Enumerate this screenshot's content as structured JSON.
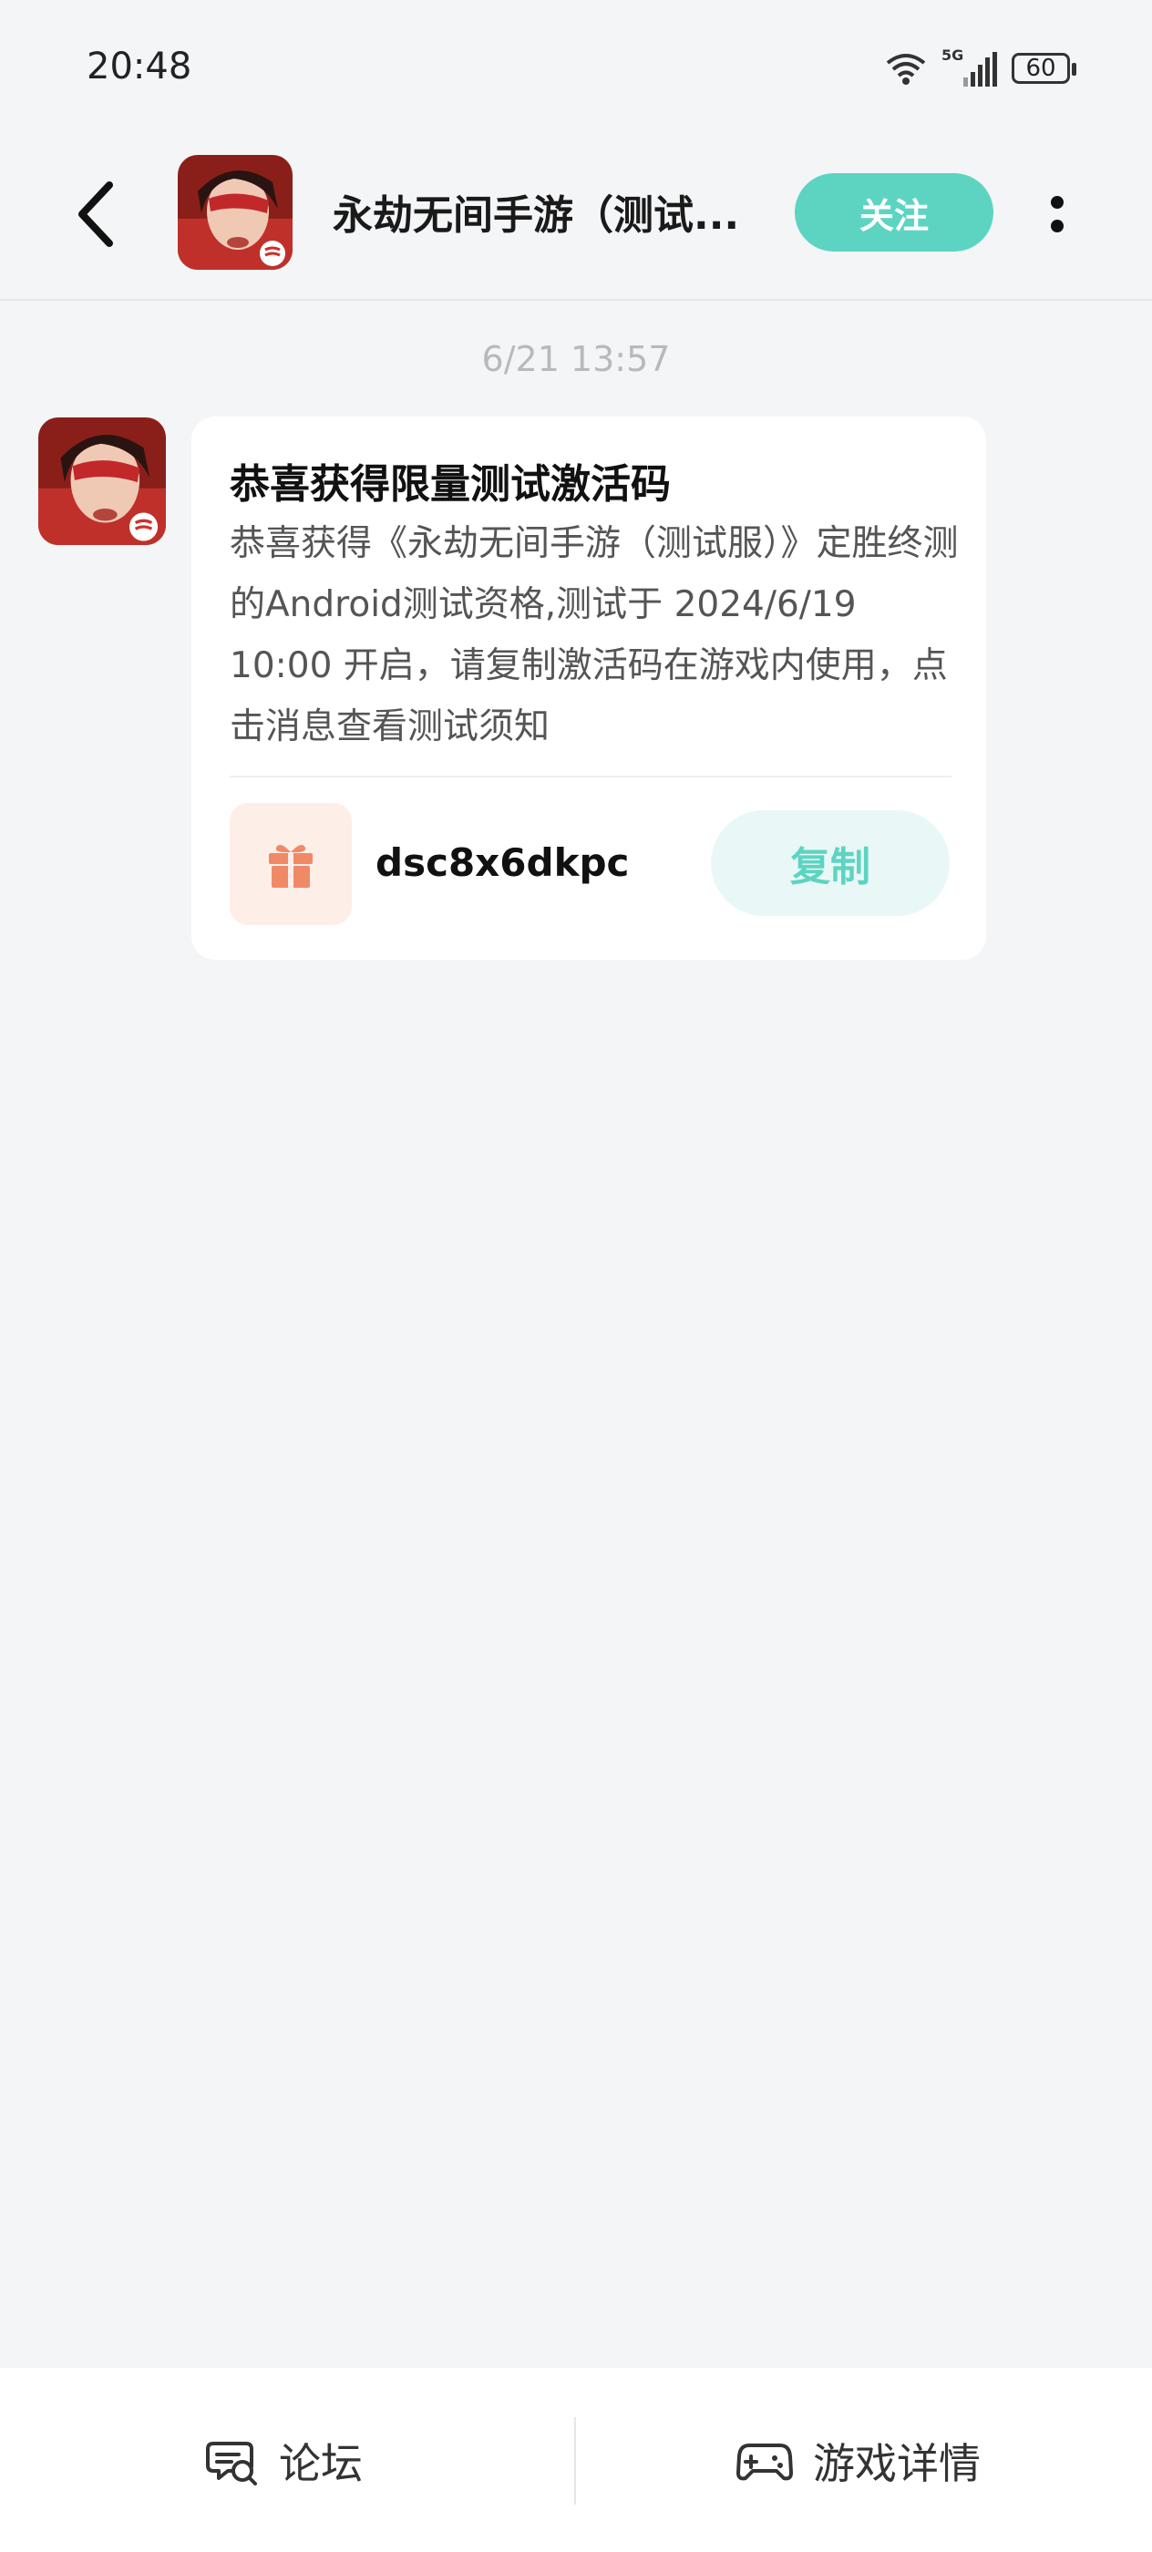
{
  "status_bar": {
    "time": "20:48",
    "network_label": "5G",
    "battery_level": "60"
  },
  "header": {
    "title": "永劫无间手游（测试...",
    "follow_label": "关注",
    "avatar_icon": "game-avatar-icon"
  },
  "conversation": {
    "timestamp": "6/21  13:57",
    "message": {
      "title": "恭喜获得限量测试激活码",
      "body": "恭喜获得《永劫无间手游（测试服）》定胜终测的Android测试资格,测试于 2024/6/19 10:00 开启，请复制激活码在游戏内使用，点击消息查看测试须知",
      "code": "dsc8x6dkpc",
      "copy_label": "复制",
      "gift_icon": "gift-icon"
    }
  },
  "bottom_nav": {
    "forum_label": "论坛",
    "details_label": "游戏详情"
  },
  "colors": {
    "accent": "#5dd4c2",
    "accent_light": "#e9f8f6",
    "gift_bg": "#fdeee8",
    "gift": "#f08a66",
    "background": "#f4f5f7"
  }
}
